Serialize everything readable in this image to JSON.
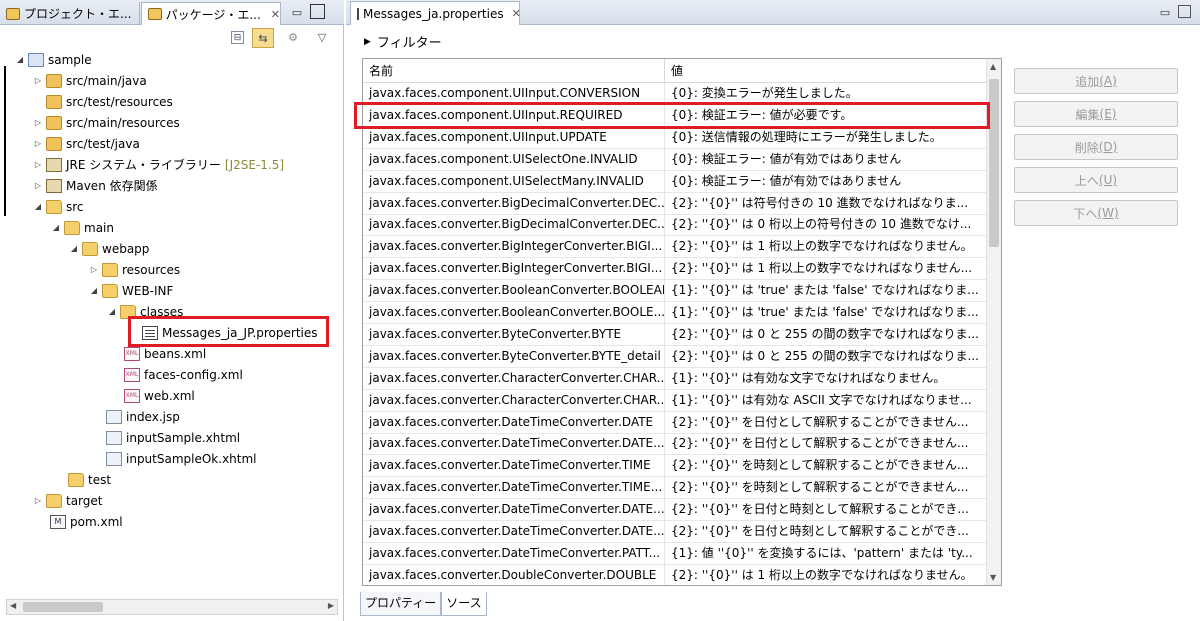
{
  "left_panel": {
    "tab_project": "プロジェクト・エ...",
    "tab_package": "パッケージ・エ...",
    "tab_close": "✕",
    "minimize": "▭",
    "maximize": "",
    "toolbar": {
      "collapse": "⊟",
      "link": "⇆",
      "filter": "⚙",
      "view_menu": "▽"
    },
    "tree": [
      {
        "label": "sample",
        "twisty": "◢",
        "icon": "project-icon"
      },
      {
        "label": "src/main/java",
        "twisty": "▷",
        "icon": "package-folder-icon"
      },
      {
        "label": "src/test/resources",
        "twisty": "",
        "icon": "package-folder-icon"
      },
      {
        "label": "src/main/resources",
        "twisty": "▷",
        "icon": "package-folder-icon"
      },
      {
        "label": "src/test/java",
        "twisty": "▷",
        "icon": "package-folder-icon"
      },
      {
        "label": "JRE システム・ライブラリー",
        "deco": "[J2SE-1.5]",
        "twisty": "▷",
        "icon": "library-icon"
      },
      {
        "label": "Maven 依存関係",
        "twisty": "▷",
        "icon": "library-icon"
      },
      {
        "label": "src",
        "twisty": "◢",
        "icon": "folder-icon"
      },
      {
        "label": "main",
        "twisty": "◢",
        "icon": "folder-icon"
      },
      {
        "label": "webapp",
        "twisty": "◢",
        "icon": "folder-icon"
      },
      {
        "label": "resources",
        "twisty": "▷",
        "icon": "folder-icon"
      },
      {
        "label": "WEB-INF",
        "twisty": "◢",
        "icon": "folder-icon"
      },
      {
        "label": "classes",
        "twisty": "◢",
        "icon": "folder-icon"
      },
      {
        "label": "Messages_ja_JP.properties",
        "twisty": "",
        "icon": "properties-file-icon"
      },
      {
        "label": "beans.xml",
        "twisty": "",
        "icon": "xml-file-icon"
      },
      {
        "label": "faces-config.xml",
        "twisty": "",
        "icon": "xml-file-icon"
      },
      {
        "label": "web.xml",
        "twisty": "",
        "icon": "xml-file-icon"
      },
      {
        "label": "index.jsp",
        "twisty": "",
        "icon": "jsp-file-icon"
      },
      {
        "label": "inputSample.xhtml",
        "twisty": "",
        "icon": "jsp-file-icon"
      },
      {
        "label": "inputSampleOk.xhtml",
        "twisty": "",
        "icon": "jsp-file-icon"
      },
      {
        "label": "test",
        "twisty": "",
        "icon": "folder-icon"
      },
      {
        "label": "target",
        "twisty": "▷",
        "icon": "folder-icon"
      },
      {
        "label": "pom.xml",
        "twisty": "",
        "icon": "pom-file-icon"
      }
    ]
  },
  "editor": {
    "tab_label": "Messages_ja.properties",
    "tab_close": "✕",
    "filter_label": "フィルター",
    "columns": {
      "name": "名前",
      "value": "値"
    },
    "rows": [
      {
        "key": "javax.faces.component.UIInput.CONVERSION",
        "value": "{0}: 変換エラーが発生しました。"
      },
      {
        "key": "javax.faces.component.UIInput.REQUIRED",
        "value": "{0}: 検証エラー: 値が必要です。"
      },
      {
        "key": "javax.faces.component.UIInput.UPDATE",
        "value": "{0}: 送信情報の処理時にエラーが発生しました。"
      },
      {
        "key": "javax.faces.component.UISelectOne.INVALID",
        "value": "{0}: 検証エラー: 値が有効ではありません"
      },
      {
        "key": "javax.faces.component.UISelectMany.INVALID",
        "value": "{0}: 検証エラー: 値が有効ではありません"
      },
      {
        "key": "javax.faces.converter.BigDecimalConverter.DEC...",
        "value": "{2}: ''{0}'' は符号付きの 10 進数でなければなりま..."
      },
      {
        "key": "javax.faces.converter.BigDecimalConverter.DEC...",
        "value": "{2}: ''{0}'' は 0 桁以上の符号付きの 10 進数でなけ..."
      },
      {
        "key": "javax.faces.converter.BigIntegerConverter.BIGI...",
        "value": "{2}: ''{0}'' は 1 桁以上の数字でなければなりません。"
      },
      {
        "key": "javax.faces.converter.BigIntegerConverter.BIGI...",
        "value": "{2}: ''{0}'' は 1 桁以上の数字でなければなりません..."
      },
      {
        "key": "javax.faces.converter.BooleanConverter.BOOLEAN",
        "value": "{1}: ''{0}'' は 'true' または 'false' でなければなりま..."
      },
      {
        "key": "javax.faces.converter.BooleanConverter.BOOLE...",
        "value": "{1}: ''{0}'' は 'true' または 'false' でなければなりま..."
      },
      {
        "key": "javax.faces.converter.ByteConverter.BYTE",
        "value": "{2}: ''{0}'' は 0 と 255 の間の数字でなければなりま..."
      },
      {
        "key": "javax.faces.converter.ByteConverter.BYTE_detail",
        "value": "{2}: ''{0}'' は 0 と 255 の間の数字でなければなりま..."
      },
      {
        "key": "javax.faces.converter.CharacterConverter.CHAR...",
        "value": "{1}: ''{0}'' は有効な文字でなければなりません。"
      },
      {
        "key": "javax.faces.converter.CharacterConverter.CHAR...",
        "value": "{1}: ''{0}'' は有効な ASCII 文字でなければなりませ..."
      },
      {
        "key": "javax.faces.converter.DateTimeConverter.DATE",
        "value": "{2}: ''{0}'' を日付として解釈することができません..."
      },
      {
        "key": "javax.faces.converter.DateTimeConverter.DATE...",
        "value": "{2}: ''{0}'' を日付として解釈することができません..."
      },
      {
        "key": "javax.faces.converter.DateTimeConverter.TIME",
        "value": "{2}: ''{0}'' を時刻として解釈することができません..."
      },
      {
        "key": "javax.faces.converter.DateTimeConverter.TIME...",
        "value": "{2}: ''{0}'' を時刻として解釈することができません..."
      },
      {
        "key": "javax.faces.converter.DateTimeConverter.DATE...",
        "value": "{2}: ''{0}'' を日付と時刻として解釈することができ..."
      },
      {
        "key": "javax.faces.converter.DateTimeConverter.DATE...",
        "value": "{2}: ''{0}'' を日付と時刻として解釈することができ..."
      },
      {
        "key": "javax.faces.converter.DateTimeConverter.PATT...",
        "value": "{1}: 値 ''{0}'' を変換するには、'pattern' または 'ty..."
      },
      {
        "key": "javax.faces.converter.DoubleConverter.DOUBLE",
        "value": "{2}: ''{0}'' は 1 桁以上の数字でなければなりません。"
      }
    ],
    "buttons": [
      {
        "label": "追加",
        "accel": "(A)"
      },
      {
        "label": "編集",
        "accel": "(E)"
      },
      {
        "label": "削除",
        "accel": "(D)"
      },
      {
        "label": "上へ",
        "accel": "(U)"
      },
      {
        "label": "下へ",
        "accel": "(W)"
      }
    ],
    "bottom_tabs": {
      "properties": "プロパティー",
      "source": "ソース"
    }
  }
}
